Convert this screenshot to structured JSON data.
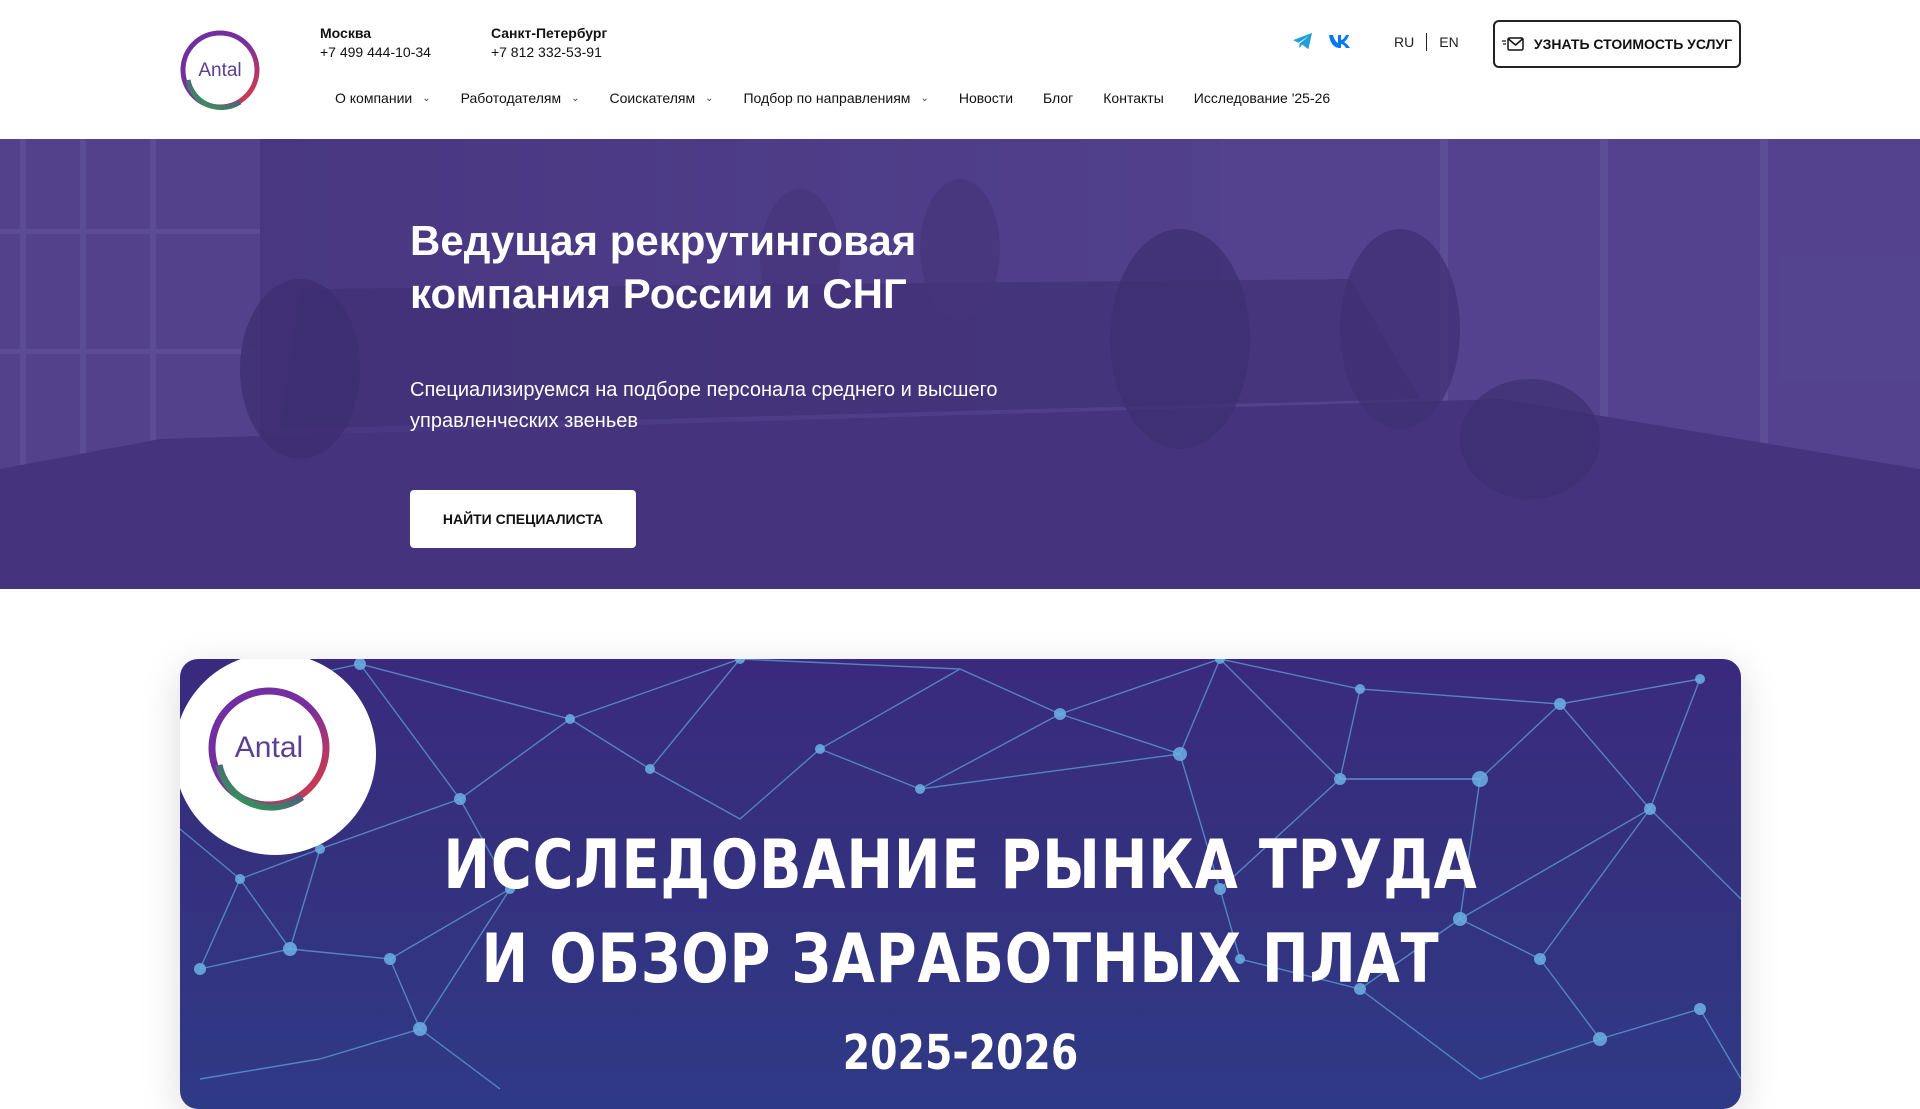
{
  "header": {
    "logo_text": "Antal",
    "phones": [
      {
        "city": "Москва",
        "number": "+7 499 444-10-34"
      },
      {
        "city": "Санкт-Петербург",
        "number": "+7 812 332-53-91"
      }
    ],
    "socials": [
      {
        "icon": "telegram-icon",
        "color": "#229ed9"
      },
      {
        "icon": "vk-icon",
        "color": "#0077ff"
      }
    ],
    "lang": {
      "ru": "RU",
      "en": "EN"
    },
    "cta_label": "УЗНАТЬ СТОИМОСТЬ УСЛУГ"
  },
  "nav": {
    "items": [
      {
        "label": "О компании",
        "has_dropdown": true
      },
      {
        "label": "Работодателям",
        "has_dropdown": true
      },
      {
        "label": "Соискателям",
        "has_dropdown": true
      },
      {
        "label": "Подбор по направлениям",
        "has_dropdown": true
      },
      {
        "label": "Новости",
        "has_dropdown": false
      },
      {
        "label": "Блог",
        "has_dropdown": false
      },
      {
        "label": "Контакты",
        "has_dropdown": false
      },
      {
        "label": "Исследование '25-26",
        "has_dropdown": false
      }
    ]
  },
  "hero": {
    "title_line1": "Ведущая рекрутинговая",
    "title_line2": "компания России и СНГ",
    "subtitle_line1": "Специализируемся на подборе персонала среднего и высшего",
    "subtitle_line2": "управленческих звеньев",
    "button_label": "НАЙТИ СПЕЦИАЛИСТА"
  },
  "banner": {
    "logo_text": "Antal",
    "title_line1": "ИССЛЕДОВАНИЕ РЫНКА ТРУДА",
    "title_line2": "И ОБЗОР ЗАРАБОТНЫХ ПЛАТ",
    "year": "2025-2026"
  },
  "colors": {
    "brand_purple": "#5a3f93",
    "hero_overlay": "#4e3a8c",
    "banner_bg": "#35307e"
  }
}
